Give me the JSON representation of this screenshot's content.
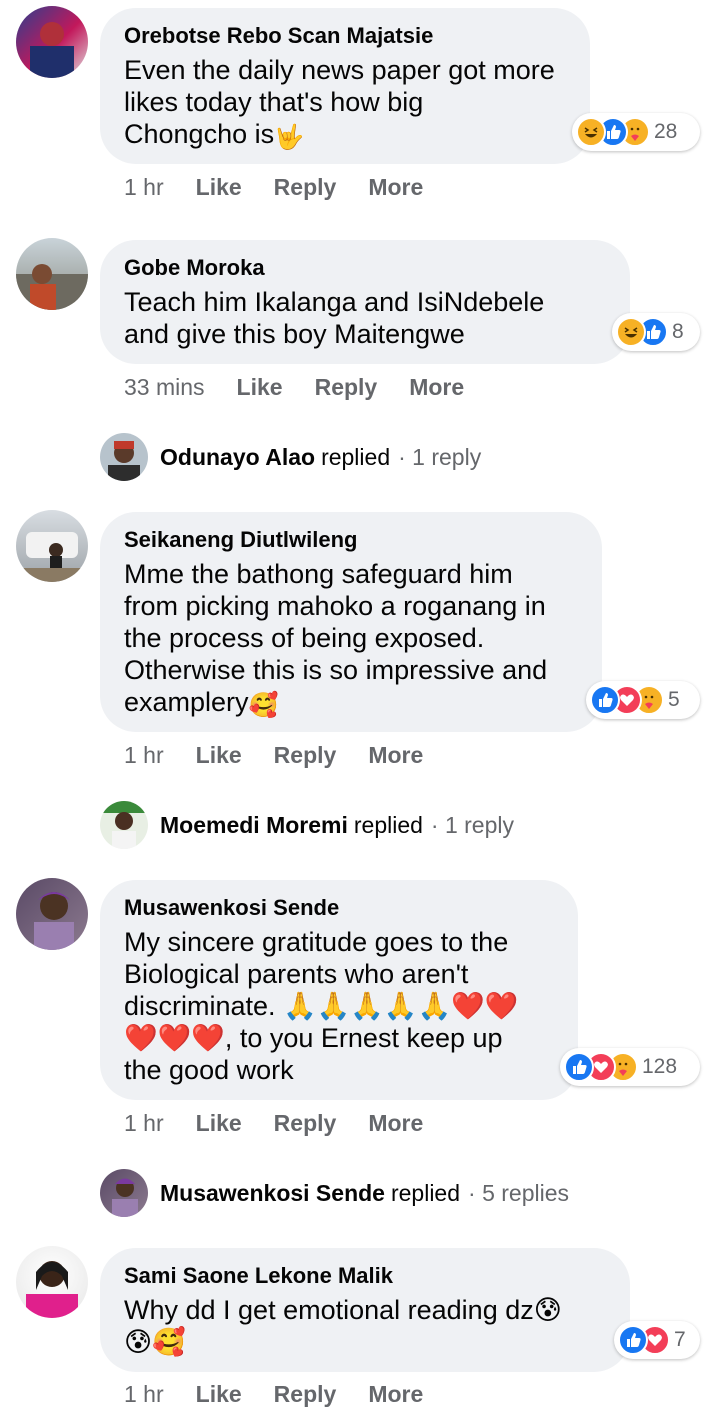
{
  "comments": [
    {
      "author": "Orebotse Rebo Scan Majatsie",
      "lines": [
        "Even the daily news paper got more",
        "likes today that's how big",
        "Chongcho is"
      ],
      "trailing_emoji": "🤟",
      "reactions": [
        "haha",
        "like",
        "care"
      ],
      "reaction_count": "28",
      "time": "1 hr"
    },
    {
      "author": "Gobe Moroka",
      "lines": [
        "Teach him Ikalanga and IsiNdebele",
        "and give this boy Maitengwe"
      ],
      "reactions": [
        "haha",
        "like"
      ],
      "reaction_count": "8",
      "time": "33 mins"
    },
    {
      "author": "Seikaneng Diutlwileng",
      "lines": [
        "Mme the bathong safeguard him",
        "from picking mahoko a roganang in",
        "the process of being exposed.",
        "Otherwise this is so impressive and",
        "examplery"
      ],
      "trailing_emoji": "🥰",
      "reactions": [
        "like",
        "love",
        "care"
      ],
      "reaction_count": "5",
      "time": "1 hr"
    },
    {
      "author": "Musawenkosi Sende",
      "lines": [
        "My sincere gratitude goes to the",
        "Biological parents who aren't",
        "discriminate. 🙏🙏🙏🙏🙏❤️❤️",
        "❤️❤️❤️, to you Ernest keep up",
        "the good work"
      ],
      "reactions": [
        "like",
        "love",
        "care"
      ],
      "reaction_count": "128",
      "time": "1 hr"
    },
    {
      "author": "Sami Saone Lekone Malik",
      "lines": [
        "Why dd I get emotional reading dz😰",
        "😰🥰"
      ],
      "reactions": [
        "like",
        "love"
      ],
      "reaction_count": "7",
      "time": "1 hr"
    }
  ],
  "actions": {
    "like": "Like",
    "reply": "Reply",
    "more": "More"
  },
  "replies": [
    {
      "name": "Odunayo Alao",
      "verb": "replied",
      "count": "· 1 reply"
    },
    {
      "name": "Moemedi Moremi",
      "verb": "replied",
      "count": "· 1 reply"
    },
    {
      "name": "Musawenkosi Sende",
      "verb": "replied",
      "count": "· 5 replies"
    }
  ],
  "colors": {
    "bubble": "#eff1f4",
    "like": "#1877f2",
    "love": "#f33e58",
    "haha": "#f7b125",
    "meta": "#65676b"
  }
}
